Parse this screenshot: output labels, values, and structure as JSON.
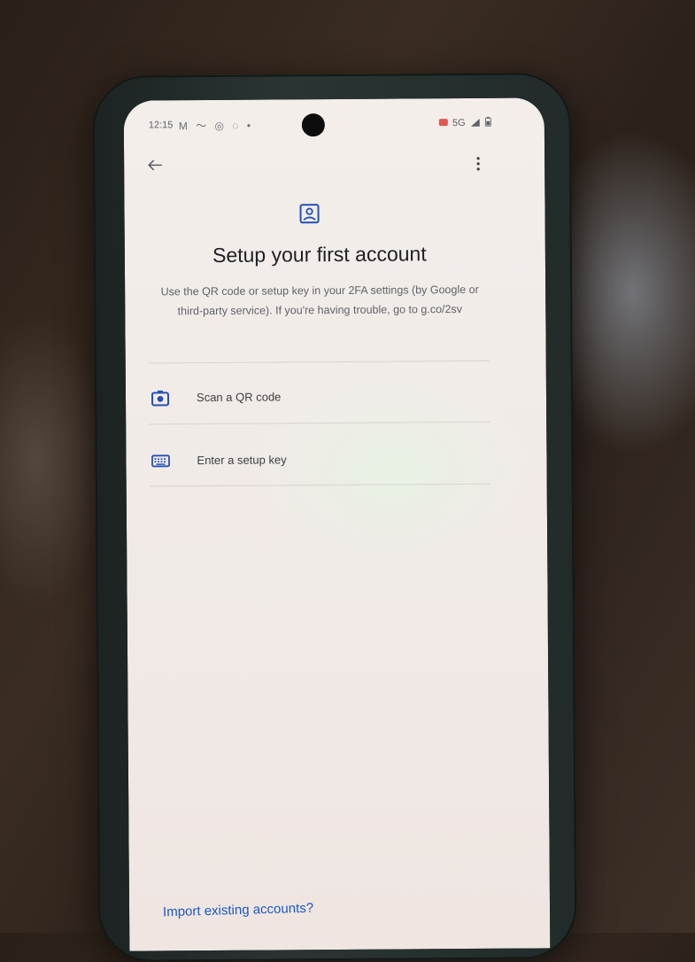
{
  "status_bar": {
    "time": "12:15",
    "left_icons": "M ～ ◎ ◌ •",
    "network": "5G"
  },
  "toolbar": {
    "back_icon": "arrow-back-icon",
    "menu_icon": "more-vert-icon"
  },
  "header": {
    "icon": "account-box-icon",
    "title": "Setup your first account",
    "subtitle": "Use the QR code or setup key in your 2FA settings (by Google or third-party service). If you're having trouble, go to g.co/2sv"
  },
  "options": [
    {
      "label": "Scan a QR code",
      "icon": "camera-icon"
    },
    {
      "label": "Enter a setup key",
      "icon": "keyboard-icon"
    }
  ],
  "footer": {
    "import_label": "Import existing accounts?"
  },
  "colors": {
    "accent": "#1a56c8",
    "icon_blue": "#2450b8",
    "title_text": "#202124",
    "body_text": "#5f6368"
  }
}
